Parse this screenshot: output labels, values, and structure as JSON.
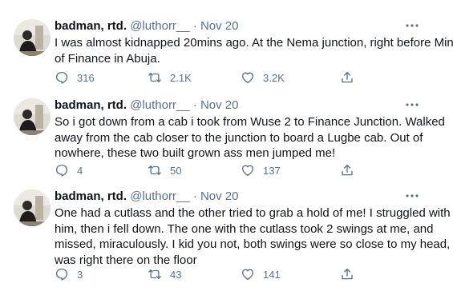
{
  "author": {
    "name": "badman, rtd.",
    "handle": "@luthorr__",
    "separator": "·"
  },
  "tweets": [
    {
      "date": "Nov 20",
      "lines": [
        "I was almost kidnapped 20mins ago. At the Nema junction, right before Min.",
        "of Finance in Abuja."
      ],
      "replies": "316",
      "retweets": "2.1K",
      "likes": "3.2K"
    },
    {
      "date": "Nov 20",
      "lines": [
        "So i got down from a cab i took from Wuse 2 to Finance Junction. Walked",
        "away from the cab closer to the junction to board a Lugbe cab. Out of",
        "nowhere, these two built grown ass men jumped me!"
      ],
      "replies": "4",
      "retweets": "50",
      "likes": "137"
    },
    {
      "date": "Nov 20",
      "lines": [
        "One had a cutlass and the other tried to grab a hold of me! I struggled with",
        "him, then i fell down. The one with the cutlass took 2 swings at me, and",
        "missed, miraculously. I kid you not, both swings were so close to my head, i",
        "was right there on the floor"
      ],
      "replies": "3",
      "retweets": "43",
      "likes": "141"
    }
  ],
  "icons": {
    "reply": "reply-icon",
    "retweet": "retweet-icon",
    "like": "heart-icon",
    "share": "share-icon",
    "more": "more-icon"
  },
  "colors": {
    "text": "#0f1419",
    "secondary": "#5b7083",
    "background": "#ffffff"
  }
}
